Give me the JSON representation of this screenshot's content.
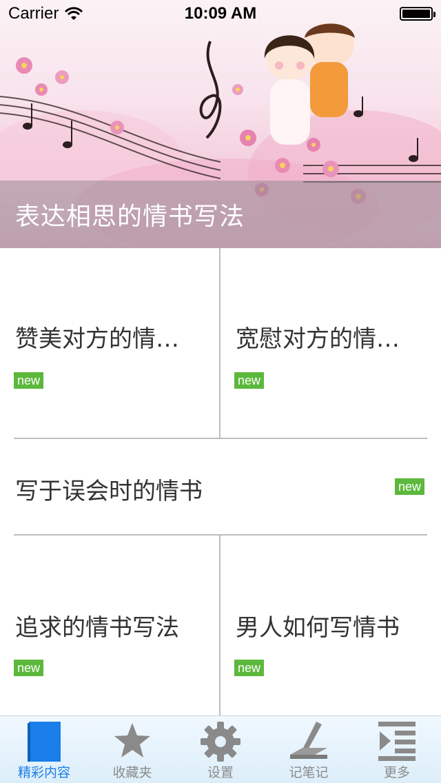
{
  "status_bar": {
    "carrier": "Carrier",
    "time": "10:09 AM"
  },
  "banner": {
    "title": "表达相思的情书写法"
  },
  "grid": {
    "row1": [
      {
        "title": "赞美对方的情…",
        "badge": "new"
      },
      {
        "title": "宽慰对方的情…",
        "badge": "new"
      }
    ],
    "row2": {
      "title": "写于误会时的情书",
      "badge": "new"
    },
    "row3": [
      {
        "title": "追求的情书写法",
        "badge": "new"
      },
      {
        "title": "男人如何写情书",
        "badge": "new"
      }
    ]
  },
  "tab_bar": {
    "tabs": [
      {
        "label": "精彩内容",
        "icon": "book-icon",
        "active": true
      },
      {
        "label": "收藏夹",
        "icon": "star-icon"
      },
      {
        "label": "设置",
        "icon": "gear-icon"
      },
      {
        "label": "记笔记",
        "icon": "pen-icon"
      },
      {
        "label": "更多",
        "icon": "more-list-icon"
      }
    ]
  },
  "colors": {
    "badge": "#5cb83c",
    "active_tab": "#1a7ee8",
    "inactive_tab": "#8a8a8a"
  }
}
